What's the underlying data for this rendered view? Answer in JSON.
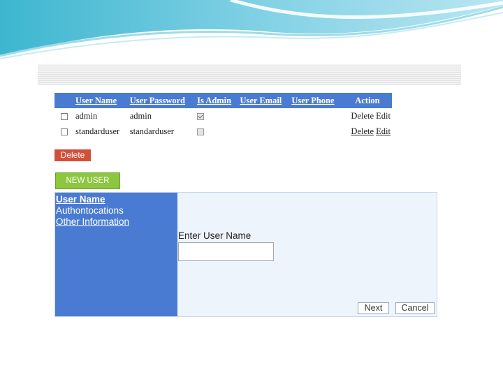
{
  "users_table": {
    "headers": [
      "User Name",
      "User Password",
      "Is Admin",
      "User Email",
      "User Phone",
      "Action"
    ],
    "rows": [
      {
        "name": "admin",
        "password": "admin",
        "is_admin": true,
        "email": "",
        "phone": "",
        "delete_label": "Delete",
        "edit_label": "Edit"
      },
      {
        "name": "standarduser",
        "password": "standarduser",
        "is_admin": false,
        "email": "",
        "phone": "",
        "delete_label": "Delete",
        "edit_label": "Edit"
      }
    ]
  },
  "buttons": {
    "delete_label": "Delete",
    "new_user_label": "NEW USER"
  },
  "wizard": {
    "steps": [
      "User Name",
      "Authontocations",
      "Other Information"
    ],
    "field_label": "Enter User Name",
    "field_value": "",
    "next_label": "Next",
    "cancel_label": "Cancel"
  },
  "colors": {
    "header_blue": "#4a7bd2",
    "delete_red": "#d2503a",
    "new_user_green": "#8dc63f",
    "panel_bg": "#eef4fc"
  }
}
